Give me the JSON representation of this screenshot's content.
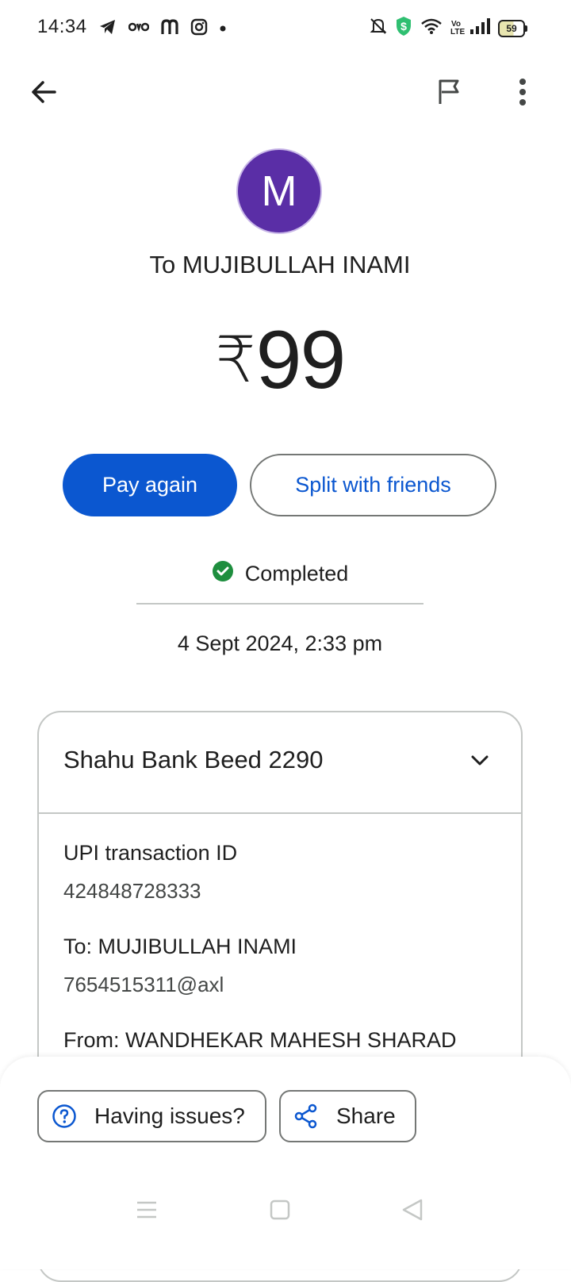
{
  "status_bar": {
    "time": "14:34",
    "left_icons": [
      "telegram-icon",
      "oyo-icon",
      "m-app-icon",
      "instagram-icon",
      "dot-icon"
    ],
    "right_icons": [
      "bell-off-icon",
      "shield-dollar-icon",
      "wifi-icon",
      "volte-icon",
      "signal-icon",
      "battery-icon"
    ],
    "volte_text": "Vo LTE",
    "battery_level": "59"
  },
  "top_bar": {
    "back_icon": "arrow-left-icon",
    "report_icon": "flag-icon",
    "more_icon": "more-vert-icon"
  },
  "payee": {
    "avatar_letter": "M",
    "avatar_color": "#5a2ea6",
    "recipient_line": "To MUJIBULLAH INAMI"
  },
  "amount": {
    "currency": "₹",
    "value": "99"
  },
  "actions": {
    "pay_again": "Pay again",
    "split": "Split with friends",
    "primary_color": "#0b57d0"
  },
  "status": {
    "label": "Completed",
    "icon": "check-circle-icon",
    "color": "#1e8e3e"
  },
  "datetime": "4 Sept 2024, 2:33 pm",
  "details": {
    "bank_account": "Shahu Bank Beed 2290",
    "upi_id_label": "UPI transaction ID",
    "upi_id_value": "424848728333",
    "to_label": "To: MUJIBULLAH INAMI",
    "to_value": "7654515311@axl",
    "from_label": "From: WANDHEKAR MAHESH SHARAD"
  },
  "bottom_actions": {
    "issues": "Having issues?",
    "share": "Share"
  },
  "nav_bar": {
    "icons": [
      "menu-icon",
      "home-square-icon",
      "back-triangle-icon"
    ]
  }
}
